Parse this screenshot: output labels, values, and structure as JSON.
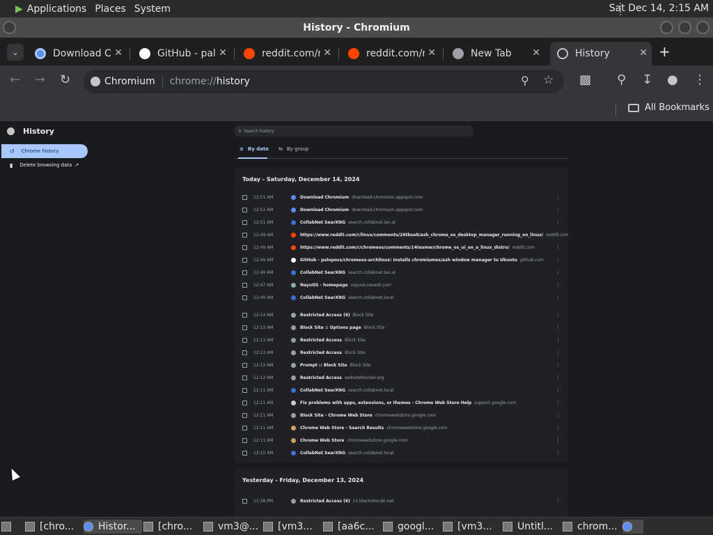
{
  "topbar": {
    "menus": [
      "Applications",
      "Places",
      "System"
    ],
    "clock": "Sat Dec 14,  2:15 AM"
  },
  "window": {
    "title": "History - Chromium"
  },
  "tabs": [
    {
      "label": "Download Ch",
      "icon": "chromium-icon",
      "color": "#5b8def"
    },
    {
      "label": "GitHub - palo",
      "icon": "github-icon",
      "color": "#ffffff"
    },
    {
      "label": "reddit.com/r/",
      "icon": "reddit-icon",
      "color": "#ff4500"
    },
    {
      "label": "reddit.com/r/",
      "icon": "reddit-icon",
      "color": "#ff4500"
    },
    {
      "label": "New Tab",
      "icon": "globe-icon",
      "color": "#9aa0a6"
    },
    {
      "label": "History",
      "icon": "history-icon",
      "color": "#c4c7c5"
    }
  ],
  "omnibox": {
    "chip": "Chromium",
    "url_scheme": "chrome://",
    "url_path": "history"
  },
  "bookmarks": {
    "all_label": "All Bookmarks"
  },
  "history_page": {
    "title": "History",
    "side_items": [
      "Chrome history",
      "Delete browsing data"
    ],
    "search_placeholder": "Search history",
    "view_tabs": [
      "By date",
      "By group"
    ],
    "groups": [
      {
        "heading": "Today - Saturday, December 14, 2024",
        "rows": [
          {
            "time": "12:51 AM",
            "title": "Download Chromium",
            "domain": "download-chromium.appspot.com",
            "favcolor": "#5b8def"
          },
          {
            "time": "12:51 AM",
            "title": "Download Chromium",
            "domain": "download-chromium.appspot.com",
            "favcolor": "#5b8def"
          },
          {
            "time": "12:51 AM",
            "title": "CollabNet SearXNG",
            "domain": "search.collabnet.lan.al",
            "favcolor": "#3b6fd8"
          },
          {
            "time": "12:49 AM",
            "title": "https://www.reddit.com/r/linux/comments/26tbse8/ash_chrome_os_desktop_manager_running_on_linux/",
            "domain": "reddit.com",
            "favcolor": "#ff4500"
          },
          {
            "time": "12:49 AM",
            "title": "https://www.reddit.com/r/chromeos/comments/14tesmw/chrome_os_ui_on_a_linux_distro/",
            "domain": "reddit.com",
            "favcolor": "#ff4500"
          },
          {
            "time": "12:49 AM",
            "title": "GitHub - paloposs/chromeos-archlinux: Installs chromiumos/ash window manager to Ubuntu",
            "domain": "github.com",
            "favcolor": "#ffffff"
          },
          {
            "time": "12:49 AM",
            "title": "CollabNet SearXNG",
            "domain": "search.collabnet.lan.al",
            "favcolor": "#3b6fd8"
          },
          {
            "time": "12:47 AM",
            "title": "NayuOS - homepage",
            "domain": "nayuos.nexedi.com",
            "favcolor": "#8aa"
          },
          {
            "time": "12:40 AM",
            "title": "CollabNet SearXNG",
            "domain": "search.collabnet.local",
            "favcolor": "#3b6fd8"
          },
          {
            "time": "12:14 AM",
            "title": "Restricted Access (6)",
            "domain": "Block Site",
            "favcolor": "#9aa0a6"
          },
          {
            "time": "12:13 AM",
            "title": "Block Site :: Options page",
            "domain": "Block Site",
            "favcolor": "#9aa0a6"
          },
          {
            "time": "12:13 AM",
            "title": "Restricted Access",
            "domain": "Block Site",
            "favcolor": "#9aa0a6"
          },
          {
            "time": "12:13 AM",
            "title": "Restricted Access",
            "domain": "Block Site",
            "favcolor": "#9aa0a6"
          },
          {
            "time": "12:13 AM",
            "title": "Prompt :: Block Site",
            "domain": "Block Site",
            "favcolor": "#9aa0a6"
          },
          {
            "time": "12:12 AM",
            "title": "Restricted Access",
            "domain": "websiteblocker.org",
            "favcolor": "#9aa0a6"
          },
          {
            "time": "12:11 AM",
            "title": "CollabNet SearXNG",
            "domain": "search.collabnet.local",
            "favcolor": "#3b6fd8"
          },
          {
            "time": "12:11 AM",
            "title": "Fix problems with apps, extensions, or themes - Chrome Web Store Help",
            "domain": "support.google.com",
            "favcolor": "#cfcfcf"
          },
          {
            "time": "12:11 AM",
            "title": "Block Site - Chrome Web Store",
            "domain": "chromewebstore.google.com",
            "favcolor": "#9aa0a6"
          },
          {
            "time": "12:11 AM",
            "title": "Chrome Web Store - Search Results",
            "domain": "chromewebstore.google.com",
            "favcolor": "#d0a060"
          },
          {
            "time": "12:11 AM",
            "title": "Chrome Web Store",
            "domain": "chromewebstore.google.com",
            "favcolor": "#d0a060"
          },
          {
            "time": "12:10 AM",
            "title": "CollabNet SearXNG",
            "domain": "search.collabnet.local",
            "favcolor": "#3b6fd8"
          }
        ]
      },
      {
        "heading": "Yesterday - Friday, December 13, 2024",
        "rows": [
          {
            "time": "11:38 PM",
            "title": "Restricted Access (6)",
            "domain": "v1.blocksitecdn.net",
            "favcolor": "#9aa0a6"
          }
        ]
      }
    ]
  },
  "taskbar": [
    {
      "label": "",
      "icon": "desktop-icon"
    },
    {
      "label": "[chro...",
      "icon": "folder-icon"
    },
    {
      "label": "Histor...",
      "icon": "chromium-icon",
      "active": true
    },
    {
      "label": "[chro...",
      "icon": "editor-icon"
    },
    {
      "label": "vm3@...",
      "icon": "terminal-icon"
    },
    {
      "label": "[vm3...",
      "icon": "terminal-icon"
    },
    {
      "label": "[aa6c...",
      "icon": "drive-icon"
    },
    {
      "label": "googl...",
      "icon": "folder-icon"
    },
    {
      "label": "[vm3...",
      "icon": "terminal-icon"
    },
    {
      "label": "Untitl...",
      "icon": "window-icon"
    },
    {
      "label": "chrom...",
      "icon": "editor-icon"
    },
    {
      "label": "",
      "icon": "chromium-icon",
      "active": true
    }
  ]
}
